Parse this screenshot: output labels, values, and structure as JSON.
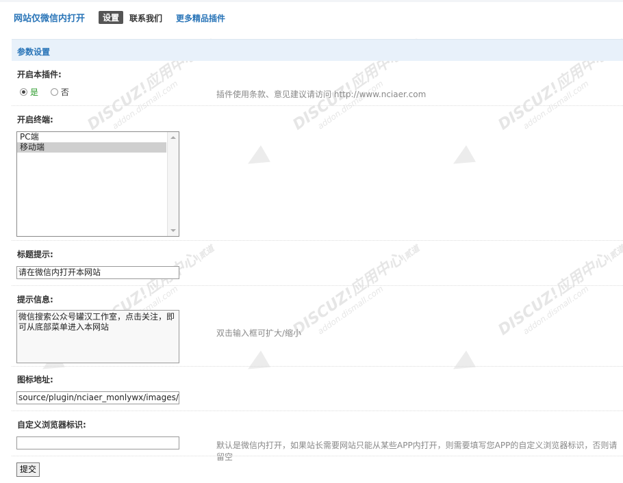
{
  "header": {
    "title": "网站仅微信内打开",
    "tabs": [
      {
        "label": "设置"
      },
      {
        "label": "联系我们"
      },
      {
        "label": "更多精品插件"
      }
    ]
  },
  "section": {
    "title": "参数设置"
  },
  "fields": {
    "enable_plugin": {
      "label": "开启本插件:",
      "options": [
        "是",
        "否"
      ],
      "selected": "是",
      "hint": "插件使用条款、意见建议请访问 http://www.nciaer.com"
    },
    "terminals": {
      "label": "开启终端:",
      "options": [
        "PC端",
        "移动端"
      ],
      "selected": "移动端"
    },
    "title_tip": {
      "label": "标题提示:",
      "value": "请在微信内打开本网站"
    },
    "tip_info": {
      "label": "提示信息:",
      "value": "微信搜索公众号罐汉工作室，点击关注，即可从底部菜单进入本网站",
      "hint": "双击输入框可扩大/缩小"
    },
    "icon_url": {
      "label": "图标地址:",
      "value": "source/plugin/nciaer_monlywx/images/w"
    },
    "custom_ua": {
      "label": "自定义浏览器标识:",
      "value": "",
      "hint": "默认是微信内打开，如果站长需要网站只能从某些APP内打开，则需要填写您APP的自定义浏览器标识，否则请留空"
    }
  },
  "submit_label": "提交",
  "watermark": {
    "brand": "DISCUZ!应用中心",
    "site": "addon.dismall.com",
    "mark": "贰道"
  },
  "colors": {
    "link": "#2a75b8",
    "section_bg": "#e8f1fa",
    "active_tab_bg": "#555555",
    "yes_green": "#2b9a2b"
  }
}
